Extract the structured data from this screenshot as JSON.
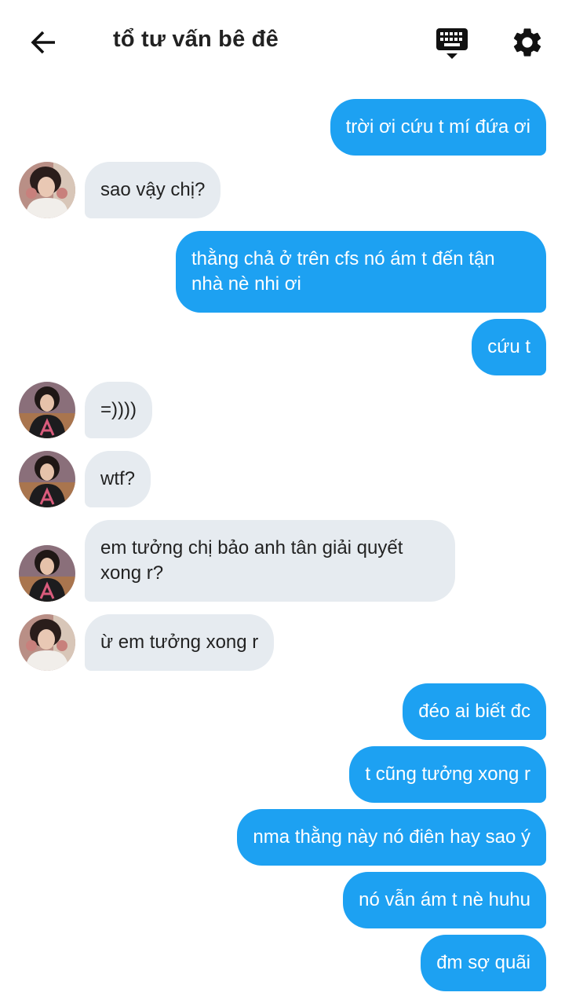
{
  "header": {
    "title": "tổ tư vấn bê đê"
  },
  "messages": [
    {
      "dir": "out",
      "text": "trời ơi cứu t mí đứa ơi"
    },
    {
      "dir": "in",
      "avatar": "avatar-1",
      "text": "sao vậy chị?"
    },
    {
      "dir": "out",
      "text": "thằng chả ở trên cfs nó ám t đến tận nhà nè nhi ơi"
    },
    {
      "dir": "out",
      "text": "cứu t"
    },
    {
      "dir": "in",
      "avatar": "avatar-2",
      "text": "=))))"
    },
    {
      "dir": "in",
      "avatar": "avatar-2",
      "text": "wtf?"
    },
    {
      "dir": "in",
      "avatar": "avatar-2",
      "text": "em tưởng chị bảo anh tân giải quyết xong r?"
    },
    {
      "dir": "in",
      "avatar": "avatar-1",
      "text": "ừ em tưởng xong r"
    },
    {
      "dir": "out",
      "text": "đéo ai biết đc"
    },
    {
      "dir": "out",
      "text": "t cũng tưởng xong r"
    },
    {
      "dir": "out",
      "text": "nma thằng này nó điên hay sao ý"
    },
    {
      "dir": "out",
      "text": "nó vẫn ám t nè huhu"
    },
    {
      "dir": "out",
      "text": "đm sợ quãi"
    }
  ],
  "colors": {
    "outgoing_bubble": "#1da1f2",
    "incoming_bubble": "#e6ebf0"
  },
  "icons": [
    "back-arrow-icon",
    "keyboard-icon",
    "gear-icon"
  ]
}
